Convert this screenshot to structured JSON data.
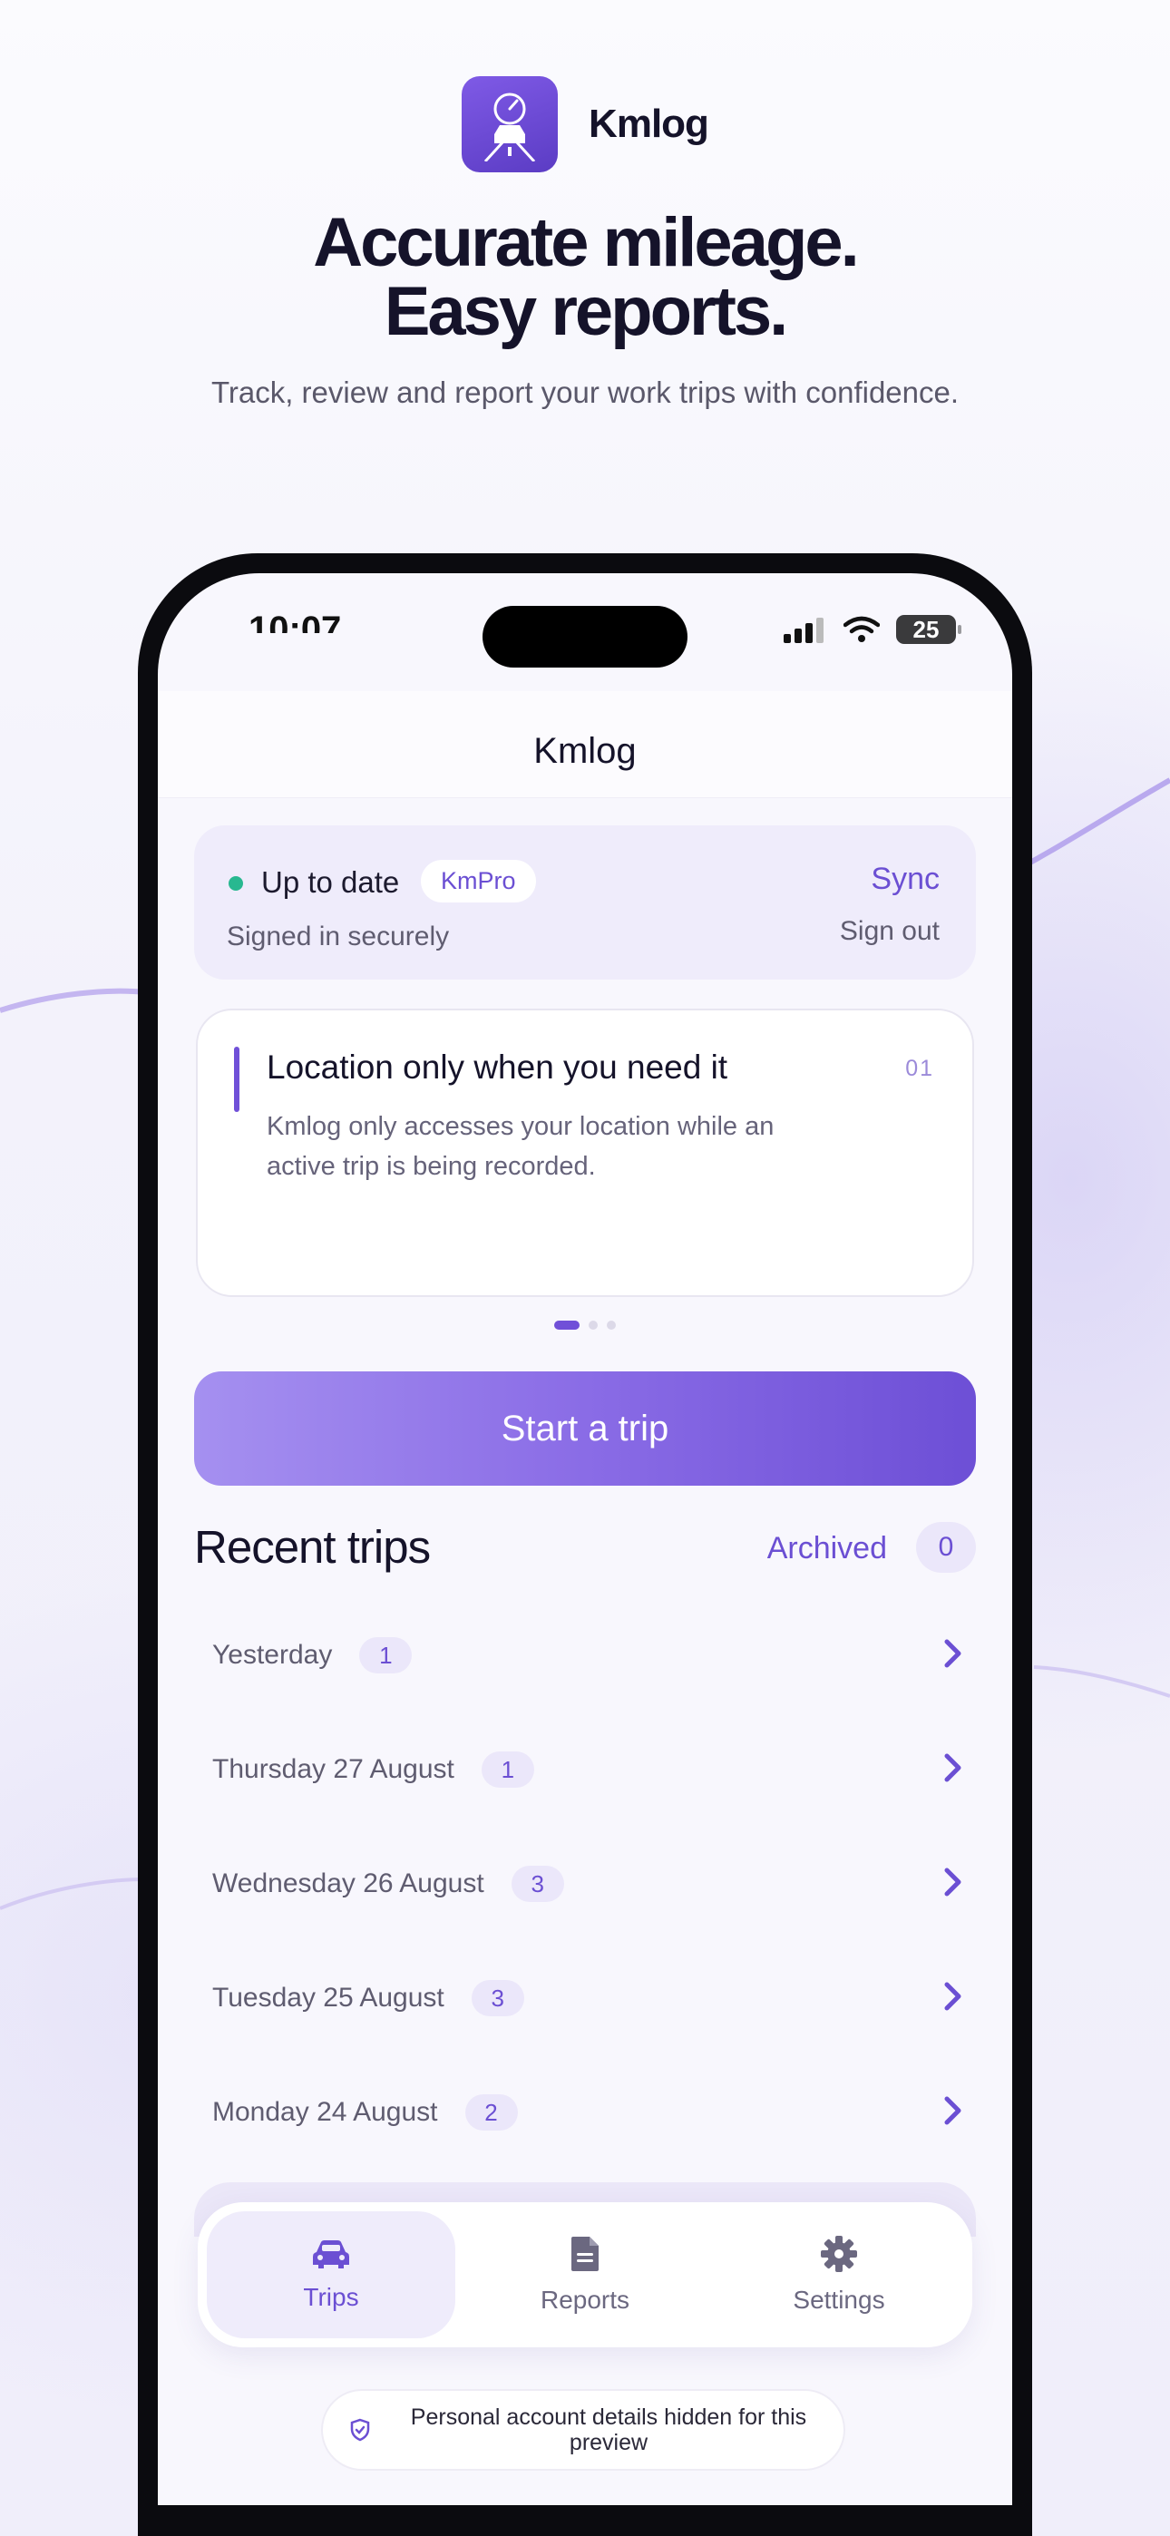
{
  "brand": {
    "name": "Kmlog",
    "icon": "speedometer-car-icon"
  },
  "hero": {
    "headline_line1": "Accurate mileage.",
    "headline_line2": "Easy reports.",
    "subhead": "Track, review and report your work trips with confidence."
  },
  "status_bar": {
    "time": "10:07",
    "battery": "25"
  },
  "nav": {
    "title": "Kmlog"
  },
  "sync_card": {
    "status": "Up to date",
    "plan": "KmPro",
    "detail": "Signed in securely",
    "sync_label": "Sync",
    "signout_label": "Sign out",
    "status_color": "#28b890"
  },
  "info_card": {
    "title": "Location only when you need it",
    "index": "01",
    "body": "Kmlog only accesses your location while an active trip is being recorded."
  },
  "start_button": {
    "label": "Start a trip"
  },
  "recent": {
    "title": "Recent trips",
    "archived_label": "Archived",
    "archived_count": "0",
    "days": [
      {
        "label": "Yesterday",
        "count": "1"
      },
      {
        "label": "Thursday 27 August",
        "count": "1"
      },
      {
        "label": "Wednesday 26 August",
        "count": "3"
      },
      {
        "label": "Tuesday 25 August",
        "count": "3"
      },
      {
        "label": "Monday 24 August",
        "count": "2"
      }
    ]
  },
  "tabs": [
    {
      "label": "Trips",
      "icon": "car-icon"
    },
    {
      "label": "Reports",
      "icon": "document-icon"
    },
    {
      "label": "Settings",
      "icon": "gear-icon"
    }
  ],
  "privacy_note": "Personal account details hidden for this preview",
  "colors": {
    "accent": "#6b4fd3",
    "accent_light": "#ebe7fa"
  }
}
